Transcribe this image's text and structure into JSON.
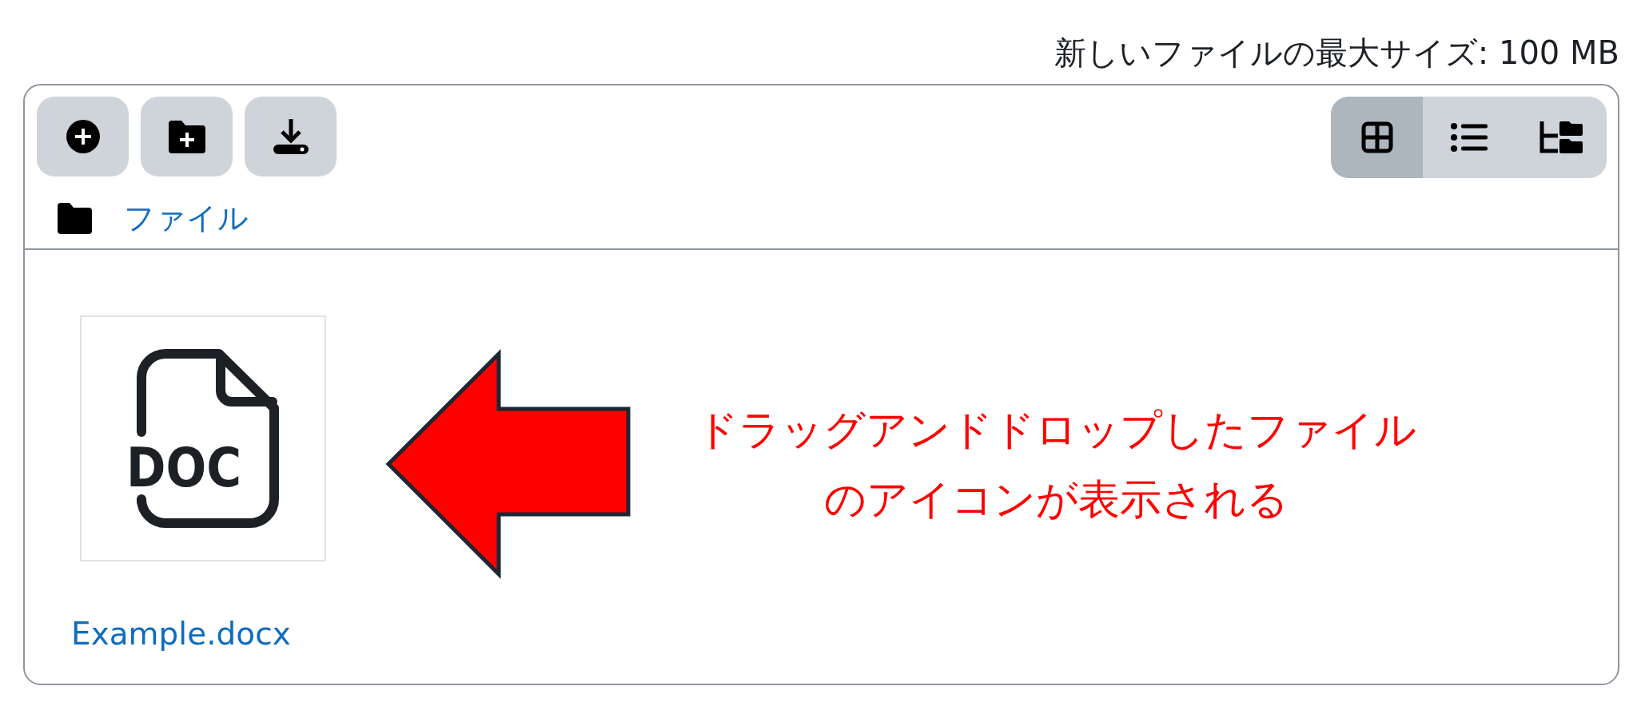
{
  "upload_limit": "新しいファイルの最大サイズ: 100 MB",
  "view_modes": [
    {
      "kind": "grid",
      "selected": true
    },
    {
      "kind": "list",
      "selected": false
    },
    {
      "kind": "tree",
      "selected": false
    }
  ],
  "breadcrumb": [
    {
      "label": "ファイル"
    }
  ],
  "files": [
    {
      "name": "Example.docx",
      "type_label": "DOC"
    }
  ],
  "annotation": {
    "lines": [
      "ドラッグアンドドロップしたファイル",
      "のアイコンが表示される"
    ]
  }
}
